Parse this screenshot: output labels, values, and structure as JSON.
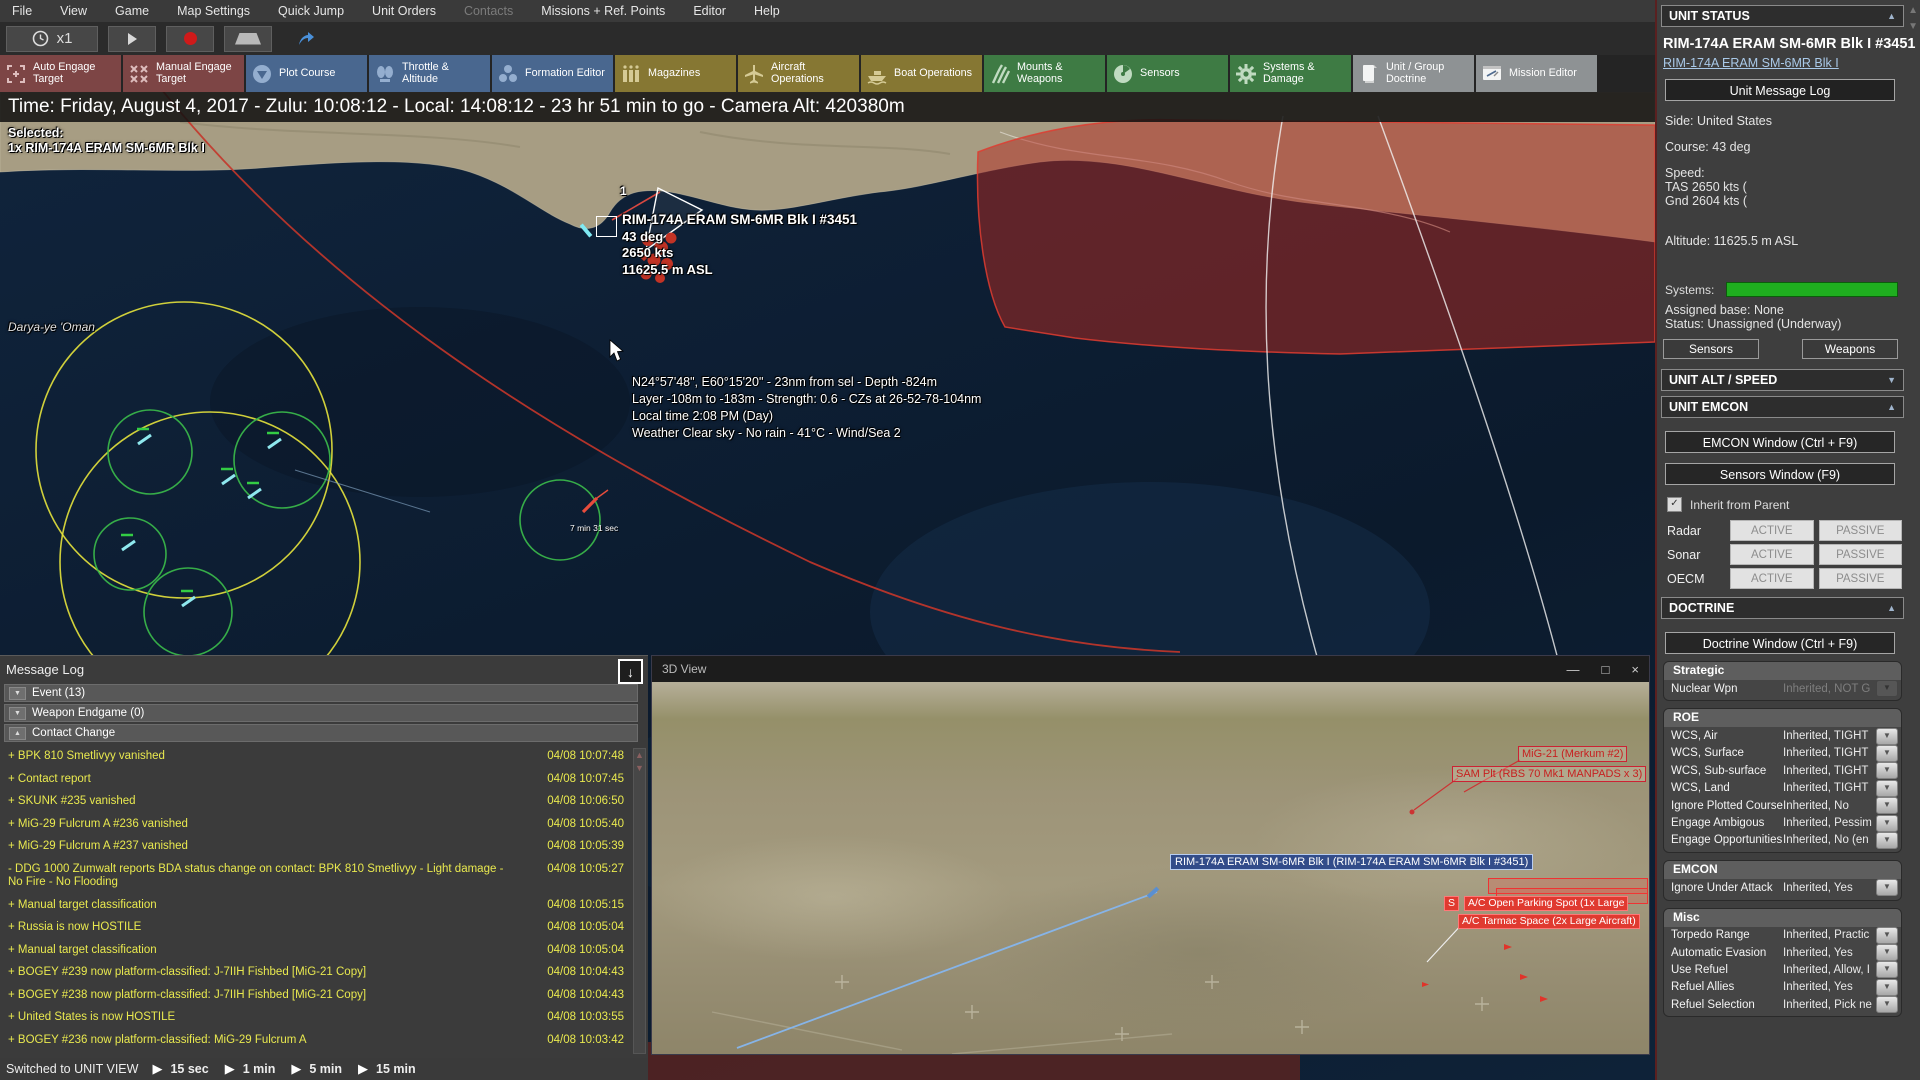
{
  "menu": {
    "items": [
      {
        "label": "File"
      },
      {
        "label": "View"
      },
      {
        "label": "Game"
      },
      {
        "label": "Map Settings"
      },
      {
        "label": "Quick Jump"
      },
      {
        "label": "Unit Orders"
      },
      {
        "label": "Contacts"
      },
      {
        "label": "Missions + Ref. Points"
      },
      {
        "label": "Editor"
      },
      {
        "label": "Help"
      }
    ]
  },
  "sim_controls": {
    "speed_label": "x1"
  },
  "toolbar": {
    "buttons": [
      {
        "label": "Auto Engage Target"
      },
      {
        "label": "Manual Engage Target"
      },
      {
        "label": "Plot Course"
      },
      {
        "label": "Throttle & Altitude"
      },
      {
        "label": "Formation Editor"
      },
      {
        "label": "Magazines"
      },
      {
        "label": "Aircraft Operations"
      },
      {
        "label": "Boat Operations"
      },
      {
        "label": "Mounts & Weapons"
      },
      {
        "label": "Sensors"
      },
      {
        "label": "Systems & Damage"
      },
      {
        "label": "Unit / Group Doctrine"
      },
      {
        "label": "Mission Editor"
      }
    ],
    "group_colors": {
      "engage": "#7d4545",
      "nav": "#49678f",
      "ops": "#867733",
      "combat": "#3e7b44",
      "editor": "#8e9294"
    }
  },
  "time_bar": {
    "text": "Time: Friday, August 4, 2017 - Zulu: 10:08:12 - Local: 14:08:12 - 23 hr 51 min to go -  Camera Alt: 420380m"
  },
  "selection": {
    "label": "Selected:",
    "value": "1x RIM-174A ERAM SM-6MR Blk I"
  },
  "map": {
    "place_label": "Darya-ye 'Oman",
    "hostile_group_count": "1",
    "intercept_eta": "7 min 31 sec",
    "selected_unit": {
      "name": "RIM-174A ERAM SM-6MR Blk I #3451",
      "course": "43 deg",
      "speed": "2650 kts",
      "altitude": "11625.5 m ASL"
    },
    "cursor_info": {
      "line1": "N24°57'48\", E60°15'20\" - 23nm from sel - Depth -824m",
      "line2": "Layer -108m to -183m - Strength: 0.6 - CZs at 26-52-78-104nm",
      "line3": "Local time 2:08 PM (Day)",
      "line4": "Weather Clear sky - No rain - 41°C - Wind/Sea 2"
    },
    "colors": {
      "hostile": "#c23325",
      "friendly": "#8fe8ee",
      "yellow_ring": "#e6e33c",
      "green_ring": "#39b54a",
      "ocean": "#0d1e33",
      "land": "#a89e84",
      "hostile_zone": "#b5352a"
    }
  },
  "message_log": {
    "title": "Message Log",
    "filters": [
      {
        "label": "Event (13)"
      },
      {
        "label": "Weapon Endgame (0)"
      },
      {
        "label": "Contact Change"
      }
    ],
    "entries": [
      {
        "prefix": "+",
        "text": "BPK 810 Smetlivyy vanished",
        "time": "04/08 10:07:48"
      },
      {
        "prefix": "+",
        "text": "Contact report",
        "time": "04/08 10:07:45"
      },
      {
        "prefix": "+",
        "text": "SKUNK #235 vanished",
        "time": "04/08 10:06:50"
      },
      {
        "prefix": "+",
        "text": "MiG-29 Fulcrum A #236 vanished",
        "time": "04/08 10:05:40"
      },
      {
        "prefix": "+",
        "text": "MiG-29 Fulcrum A #237 vanished",
        "time": "04/08 10:05:39"
      },
      {
        "prefix": "-",
        "text": "DDG 1000 Zumwalt reports BDA status change on contact: BPK 810 Smetlivyy - Light damage - No Fire - No Flooding",
        "time": "04/08 10:05:27"
      },
      {
        "prefix": "+",
        "text": "Manual target classification",
        "time": "04/08 10:05:15"
      },
      {
        "prefix": "+",
        "text": "Russia is now HOSTILE",
        "time": "04/08 10:05:04"
      },
      {
        "prefix": "+",
        "text": "Manual target classification",
        "time": "04/08 10:05:04"
      },
      {
        "prefix": "+",
        "text": "BOGEY #239 now platform-classified: J-7IIH Fishbed [MiG-21 Copy]",
        "time": "04/08 10:04:43"
      },
      {
        "prefix": "+",
        "text": "BOGEY #238 now platform-classified: J-7IIH Fishbed [MiG-21 Copy]",
        "time": "04/08 10:04:43"
      },
      {
        "prefix": "+",
        "text": "United States is now HOSTILE",
        "time": "04/08 10:03:55"
      },
      {
        "prefix": "+",
        "text": "BOGEY #236 now platform-classified: MiG-29 Fulcrum A",
        "time": "04/08 10:03:42"
      }
    ]
  },
  "view3d": {
    "title": "3D View",
    "buttons": {
      "minimize": "—",
      "maximize": "□",
      "close": "×"
    },
    "labels": {
      "mig": "MiG-21 (Merkum #2)",
      "sam": "SAM Plt (RBS 70 Mk1 MANPADS x 3)",
      "missile": "RIM-174A ERAM SM-6MR Blk I (RIM-174A ERAM SM-6MR Blk I #3451)",
      "stack_partial": "S",
      "parking": "A/C Open Parking Spot (1x Large",
      "tarmac": "A/C Tarmac Space (2x Large Aircraft)"
    }
  },
  "bottom_bar": {
    "status": "Switched to UNIT VIEW",
    "steps": [
      {
        "label": "15 sec"
      },
      {
        "label": "1 min"
      },
      {
        "label": "5 min"
      },
      {
        "label": "15 min"
      }
    ]
  },
  "unit_status": {
    "header": "UNIT STATUS",
    "unit_name": "RIM-174A ERAM SM-6MR Blk I #3451",
    "unit_class_link": "RIM-174A ERAM SM-6MR Blk I",
    "message_log_button": "Unit Message Log",
    "side": "Side: United States",
    "course": "Course: 43 deg",
    "speed_label": "Speed:",
    "speed_tas": "TAS 2650 kts (",
    "speed_gnd": "Gnd 2604 kts (",
    "altitude": "Altitude: 11625.5 m ASL",
    "systems_label": "Systems:",
    "systems_bar_color": "#1fae1f",
    "assigned_base": "Assigned base: None",
    "status": "Status: Unassigned (Underway)",
    "sensors_button": "Sensors",
    "weapons_button": "Weapons"
  },
  "unit_alt_speed": {
    "header": "UNIT ALT / SPEED"
  },
  "unit_emcon": {
    "header": "UNIT EMCON",
    "emcon_window_button": "EMCON Window (Ctrl + F9)",
    "sensors_window_button": "Sensors Window (F9)",
    "inherit_checkbox": "Inherit from Parent",
    "inherit_checked": true,
    "active_label": "ACTIVE",
    "passive_label": "PASSIVE",
    "rows": [
      {
        "label": "Radar"
      },
      {
        "label": "Sonar"
      },
      {
        "label": "OECM"
      }
    ]
  },
  "doctrine": {
    "header": "DOCTRINE",
    "window_button": "Doctrine Window (Ctrl + F9)",
    "strategic": {
      "title": "Strategic",
      "rows": [
        {
          "label": "Nuclear Wpn",
          "value": "Inherited, NOT G"
        }
      ]
    },
    "roe": {
      "title": "ROE",
      "rows": [
        {
          "label": "WCS, Air",
          "value": "Inherited, TIGHT"
        },
        {
          "label": "WCS, Surface",
          "value": "Inherited, TIGHT"
        },
        {
          "label": "WCS, Sub-surface",
          "value": "Inherited, TIGHT"
        },
        {
          "label": "WCS, Land",
          "value": "Inherited, TIGHT"
        },
        {
          "label": "Ignore Plotted Course",
          "value": "Inherited, No"
        },
        {
          "label": "Engage Ambigous",
          "value": "Inherited, Pessim"
        },
        {
          "label": "Engage Opportunities",
          "value": "Inherited, No (en"
        }
      ]
    },
    "emcon": {
      "title": "EMCON",
      "rows": [
        {
          "label": "Ignore Under Attack",
          "value": "Inherited, Yes"
        }
      ]
    },
    "misc": {
      "title": "Misc",
      "rows": [
        {
          "label": "Torpedo Range",
          "value": "Inherited, Practic"
        },
        {
          "label": "Automatic Evasion",
          "value": "Inherited, Yes"
        },
        {
          "label": "Use Refuel",
          "value": "Inherited, Allow, I"
        },
        {
          "label": "Refuel Allies",
          "value": "Inherited, Yes"
        },
        {
          "label": "Refuel Selection",
          "value": "Inherited, Pick ne"
        }
      ]
    }
  }
}
